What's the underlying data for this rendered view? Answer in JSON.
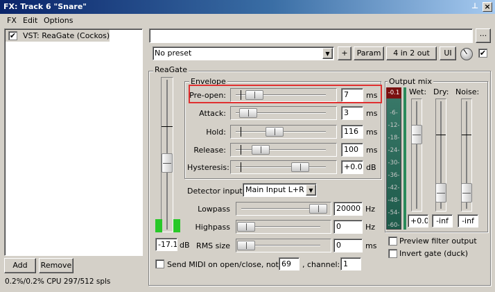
{
  "window": {
    "title": "FX: Track 6 \"Snare\"",
    "pin_glyph": "⊥",
    "close_glyph": "×"
  },
  "menu": {
    "fx": "FX",
    "edit": "Edit",
    "options": "Options"
  },
  "plugin_list": {
    "items": [
      {
        "name": "VST: ReaGate (Cockos)",
        "enabled": "✔"
      }
    ]
  },
  "left_buttons": {
    "add": "Add",
    "remove": "Remove"
  },
  "status": {
    "cpu": "0.2%/0.2% CPU 297/512 spls"
  },
  "top_bar": {
    "preset_name": "",
    "browse_label": "...",
    "preset": "No preset",
    "preset_arrow": "▼",
    "plus_label": "+",
    "param_label": "Param",
    "io_label": "4 in 2 out",
    "ui_label": "UI",
    "bypass_check": "✔"
  },
  "reagate": {
    "group_label": "ReaGate",
    "envelope_label": "Envelope",
    "envelope": [
      {
        "label": "Pre-open:",
        "value": "7",
        "unit": "ms",
        "position": 0.15
      },
      {
        "label": "Attack:",
        "value": "3",
        "unit": "ms",
        "position": 0.08
      },
      {
        "label": "Hold:",
        "value": "116",
        "unit": "ms",
        "position": 0.38
      },
      {
        "label": "Release:",
        "value": "100",
        "unit": "ms",
        "position": 0.22
      },
      {
        "label": "Hysteresis:",
        "value": "+0.0",
        "unit": "dB",
        "position": 0.68
      }
    ],
    "threshold": {
      "value": "-17.1",
      "unit": "dB",
      "position": 0.57
    },
    "detector": {
      "label": "Detector input:",
      "value": "Main Input L+R",
      "arrow": "▼"
    },
    "filters": [
      {
        "label": "Lowpass",
        "value": "20000",
        "unit": "Hz",
        "position": 0.97
      },
      {
        "label": "Highpass",
        "value": "0",
        "unit": "Hz",
        "position": 0.0
      },
      {
        "label": "RMS size",
        "value": "0",
        "unit": "ms",
        "position": 0.0
      }
    ],
    "midi": {
      "label": "Send MIDI on open/close, note:",
      "note": "69",
      "channel_label": ", channel:",
      "channel": "1"
    },
    "output_mix": {
      "label": "Output mix",
      "meter_peak": "-0.1",
      "meter_scale": [
        "-6-",
        "-12-",
        "-18-",
        "-24-",
        "-30-",
        "-36-",
        "-42-",
        "-48-",
        "-54-",
        "-60-"
      ],
      "wet": {
        "label": "Wet:",
        "value": "+0.0",
        "position": 0.28
      },
      "dry": {
        "label": "Dry:",
        "value": "-inf",
        "position": 0.92
      },
      "noise": {
        "label": "Noise:",
        "value": "-inf",
        "position": 0.92
      },
      "preview_label": "Preview filter output",
      "invert_label": "Invert gate (duck)"
    }
  }
}
